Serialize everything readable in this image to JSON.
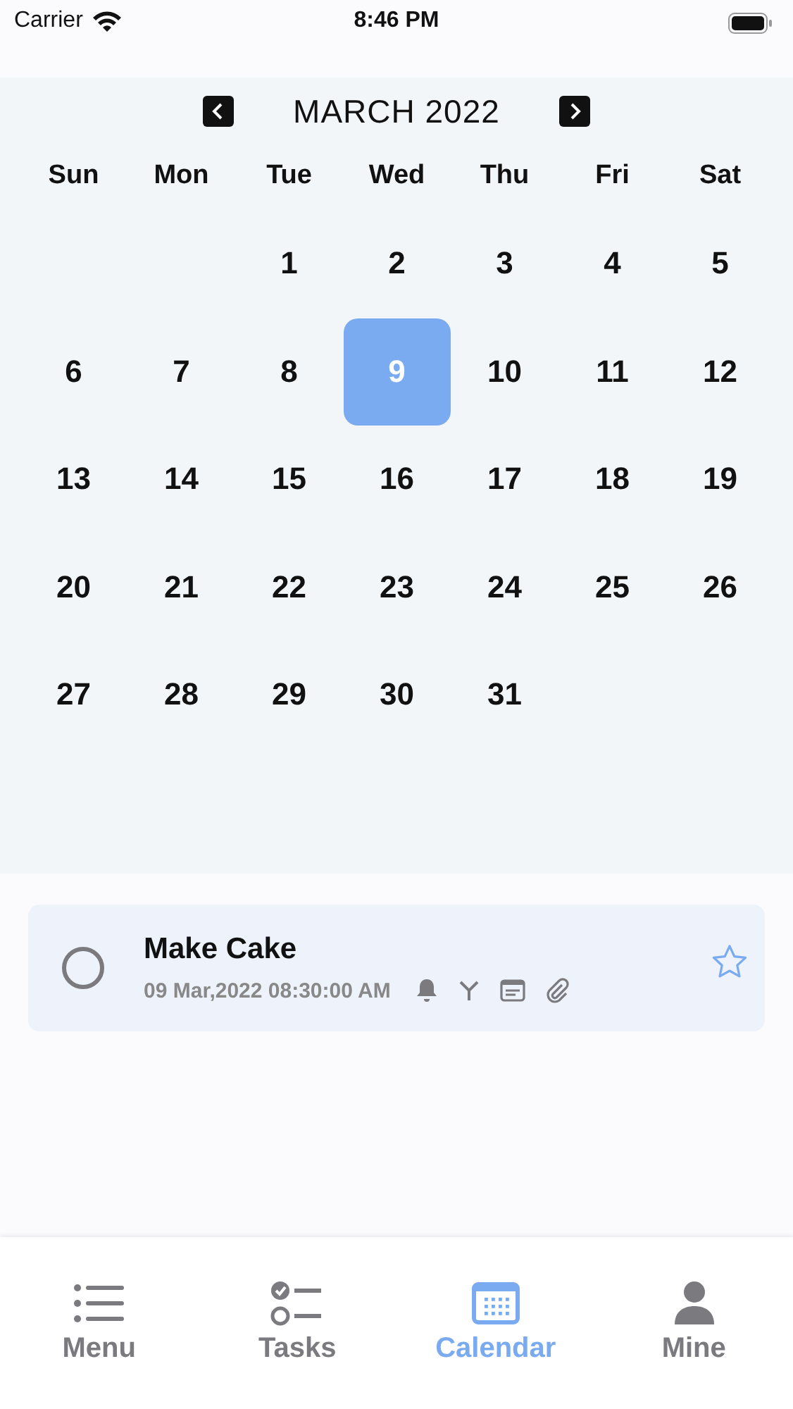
{
  "status_bar": {
    "carrier": "Carrier",
    "time": "8:46 PM"
  },
  "calendar": {
    "month_title": "MARCH 2022",
    "weekdays": [
      "Sun",
      "Mon",
      "Tue",
      "Wed",
      "Thu",
      "Fri",
      "Sat"
    ],
    "weeks": [
      [
        {
          "kind": "blank"
        },
        {
          "kind": "blank"
        },
        {
          "kind": "day",
          "label": "1",
          "selected": false
        },
        {
          "kind": "day",
          "label": "2",
          "selected": false
        },
        {
          "kind": "day",
          "label": "3",
          "selected": false
        },
        {
          "kind": "day",
          "label": "4",
          "selected": false
        },
        {
          "kind": "day",
          "label": "5",
          "selected": false
        }
      ],
      [
        {
          "kind": "day",
          "label": "6",
          "selected": false
        },
        {
          "kind": "day",
          "label": "7",
          "selected": false
        },
        {
          "kind": "day",
          "label": "8",
          "selected": false
        },
        {
          "kind": "day",
          "label": "9",
          "selected": true
        },
        {
          "kind": "day",
          "label": "10",
          "selected": false
        },
        {
          "kind": "day",
          "label": "11",
          "selected": false
        },
        {
          "kind": "day",
          "label": "12",
          "selected": false
        }
      ],
      [
        {
          "kind": "day",
          "label": "13",
          "selected": false
        },
        {
          "kind": "day",
          "label": "14",
          "selected": false
        },
        {
          "kind": "day",
          "label": "15",
          "selected": false
        },
        {
          "kind": "day",
          "label": "16",
          "selected": false
        },
        {
          "kind": "day",
          "label": "17",
          "selected": false
        },
        {
          "kind": "day",
          "label": "18",
          "selected": false
        },
        {
          "kind": "day",
          "label": "19",
          "selected": false
        }
      ],
      [
        {
          "kind": "day",
          "label": "20",
          "selected": false
        },
        {
          "kind": "day",
          "label": "21",
          "selected": false
        },
        {
          "kind": "day",
          "label": "22",
          "selected": false
        },
        {
          "kind": "day",
          "label": "23",
          "selected": false
        },
        {
          "kind": "day",
          "label": "24",
          "selected": false
        },
        {
          "kind": "day",
          "label": "25",
          "selected": false
        },
        {
          "kind": "day",
          "label": "26",
          "selected": false
        }
      ],
      [
        {
          "kind": "day",
          "label": "27",
          "selected": false
        },
        {
          "kind": "day",
          "label": "28",
          "selected": false
        },
        {
          "kind": "day",
          "label": "29",
          "selected": false
        },
        {
          "kind": "day",
          "label": "30",
          "selected": false
        },
        {
          "kind": "day",
          "label": "31",
          "selected": false
        },
        {
          "kind": "blank"
        },
        {
          "kind": "blank"
        }
      ]
    ]
  },
  "tasks": [
    {
      "title": "Make Cake",
      "datetime": "09 Mar,2022 08:30:00 AM",
      "checked": false,
      "starred": false
    }
  ],
  "tab_bar": [
    {
      "kind": "menu",
      "label": "Menu",
      "selected": false
    },
    {
      "kind": "tasks",
      "label": "Tasks",
      "selected": false
    },
    {
      "kind": "calendar",
      "label": "Calendar",
      "selected": true
    },
    {
      "kind": "mine",
      "label": "Mine",
      "selected": false
    }
  ]
}
